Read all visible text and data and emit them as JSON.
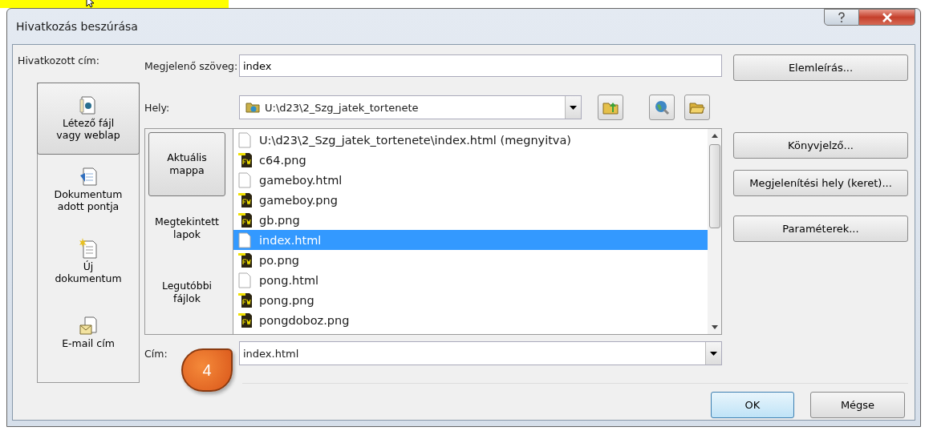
{
  "window": {
    "title": "Hivatkozás beszúrása"
  },
  "link_to": {
    "label": "Hivatkozott cím:",
    "items": [
      {
        "label": "Létező fájl\nvagy weblap",
        "kind": "file",
        "selected": true
      },
      {
        "label": "Dokumentum\nadott pontja",
        "kind": "place",
        "selected": false
      },
      {
        "label": "Új\ndokumentum",
        "kind": "new",
        "selected": false
      },
      {
        "label": "E-mail cím",
        "kind": "email",
        "selected": false
      }
    ]
  },
  "display_text": {
    "label": "Megjelenő szöveg:",
    "value": "index"
  },
  "look_in": {
    "label": "Hely:",
    "value": "U:\\d23\\2_Szg_jatek_tortenete"
  },
  "views": [
    {
      "label": "Aktuális\nmappa",
      "selected": true
    },
    {
      "label": "Megtekintett\nlapok",
      "selected": false
    },
    {
      "label": "Legutóbbi\nfájlok",
      "selected": false
    }
  ],
  "files": [
    {
      "name": "U:\\d23\\2_Szg_jatek_tortenete\\index.html (megnyitva)",
      "kind": "html",
      "selected": false
    },
    {
      "name": "c64.png",
      "kind": "fw",
      "selected": false
    },
    {
      "name": "gameboy.html",
      "kind": "html",
      "selected": false
    },
    {
      "name": "gameboy.png",
      "kind": "fw",
      "selected": false
    },
    {
      "name": "gb.png",
      "kind": "fw",
      "selected": false
    },
    {
      "name": "index.html",
      "kind": "html",
      "selected": true
    },
    {
      "name": "po.png",
      "kind": "fw",
      "selected": false
    },
    {
      "name": "pong.html",
      "kind": "html",
      "selected": false
    },
    {
      "name": "pong.png",
      "kind": "fw",
      "selected": false
    },
    {
      "name": "pongdoboz.png",
      "kind": "fw",
      "selected": false
    }
  ],
  "address": {
    "label": "Cím:",
    "value": "index.html"
  },
  "side_buttons": [
    "Elemleírás...",
    "Könyvjelző...",
    "Megjelenítési hely (keret)...",
    "Paraméterek..."
  ],
  "buttons": [
    {
      "label": "OK",
      "default": true
    },
    {
      "label": "Mégse",
      "default": false
    }
  ],
  "callout": {
    "text": "4"
  }
}
